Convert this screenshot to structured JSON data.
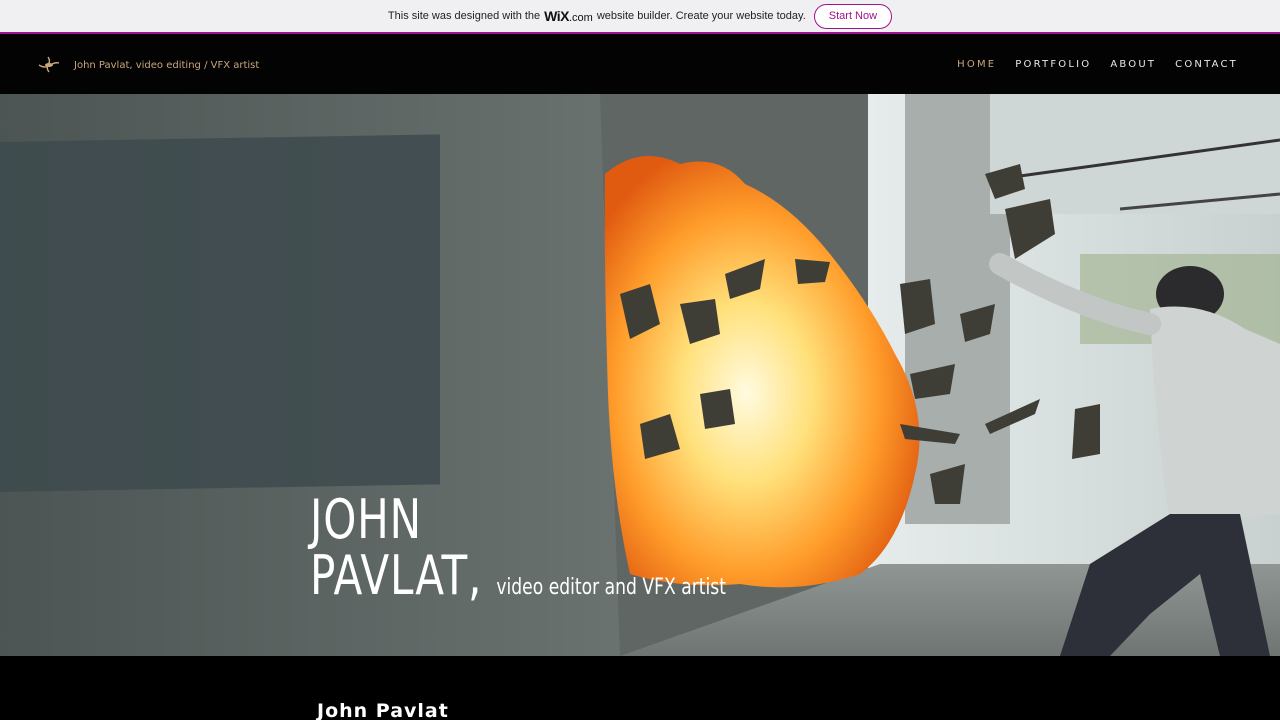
{
  "banner": {
    "text_before": "This site was designed with the",
    "brand": "WiX",
    "brand_suffix": ".com",
    "text_after": "website builder. Create your website today.",
    "cta": "Start Now"
  },
  "header": {
    "site_title": "John Pavlat, video editing / VFX artist",
    "logo_icon": "lamp-logo-icon",
    "nav": [
      {
        "label": "HOME",
        "active": true
      },
      {
        "label": "PORTFOLIO",
        "active": false
      },
      {
        "label": "ABOUT",
        "active": false
      },
      {
        "label": "CONTACT",
        "active": false
      }
    ]
  },
  "hero": {
    "line1": "JOHN",
    "line2": "PAVLAT,",
    "subtitle": "video editor and VFX artist"
  },
  "section": {
    "name": "John Pavlat"
  },
  "colors": {
    "accent": "#c9a77c",
    "wix_purple": "#a0138e"
  }
}
